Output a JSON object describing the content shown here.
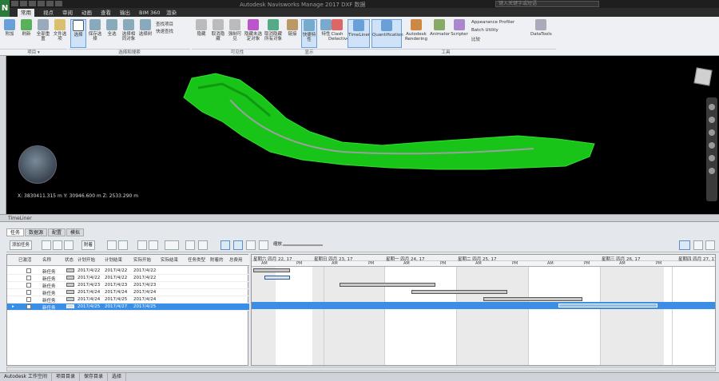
{
  "titlebar": {
    "title": "Autodesk Navisworks Manage 2017  DXF 数据",
    "search_placeholder": "键入关键字或短语"
  },
  "tabs": [
    "常用",
    "视点",
    "审阅",
    "动画",
    "查看",
    "输出",
    "BIM 360",
    "渲染"
  ],
  "ribbon": {
    "project_buttons": [
      "附加",
      "刷新",
      "全部重置",
      "文件选项"
    ],
    "select_buttons": [
      "选择",
      "保存选择",
      "全选",
      "选择相同对象",
      "选择树"
    ],
    "find_items": "查找项目",
    "quick_find": "快速查找",
    "select_group_label": "选择和搜索",
    "visibility_buttons": [
      "隐藏",
      "取消隐藏",
      "强制可见",
      "隐藏未选定对象",
      "取消隐藏所有对象"
    ],
    "visibility_group_label": "可见性",
    "display_buttons": [
      "链接",
      "快捷特性",
      "特性"
    ],
    "display_group_label": "显示",
    "tools_buttons": [
      "Clash Detective",
      "TimeLiner",
      "Quantification",
      "Autodesk Rendering",
      "Animator",
      "Scripter"
    ],
    "appearance_profiler": "Appearance Profiler",
    "batch_utility": "Batch Utility",
    "compare": "比较",
    "datatools": "DataTools",
    "tools_group_label": "工具"
  },
  "viewport": {
    "coords": "X: 3830411.315 m  Y: 30946.600 m  Z: 2533.290 m"
  },
  "panel": {
    "title": "TimeLiner",
    "tabs": [
      "任务",
      "数据源",
      "配置",
      "模拟"
    ],
    "toolbar": [
      "添加任务",
      "附着",
      "自动附着",
      "导出",
      "缩放"
    ]
  },
  "task_grid": {
    "headers": [
      "已激活",
      "名称",
      "状态",
      "计划开始",
      "计划结束",
      "实际开始",
      "实际结束",
      "任务类型",
      "附着的",
      "总费用"
    ],
    "rows": [
      {
        "name": "新任务",
        "start": "2017/4/22",
        "end": "2017/4/22",
        "actual": "2017/4/22",
        "selected": false
      },
      {
        "name": "新任务",
        "start": "2017/4/22",
        "end": "2017/4/22",
        "actual": "2017/4/22",
        "selected": false
      },
      {
        "name": "新任务",
        "start": "2017/4/23",
        "end": "2017/4/23",
        "actual": "2017/4/23",
        "selected": false
      },
      {
        "name": "新任务",
        "start": "2017/4/24",
        "end": "2017/4/24",
        "actual": "2017/4/24",
        "selected": false
      },
      {
        "name": "新任务",
        "start": "2017/4/24",
        "end": "2017/4/25",
        "actual": "2017/4/24",
        "selected": false
      },
      {
        "name": "新任务",
        "start": "2017/4/25",
        "end": "2017/4/27",
        "actual": "2017/4/25",
        "selected": true
      }
    ]
  },
  "gantt": {
    "days": [
      "星期六 四月 22, 17",
      "星期日 四月 23, 17",
      "星期一 四月 24, 17",
      "星期二 四月 25, 17",
      "星期三 四月 26, 17",
      "星期四 四月 27, 17"
    ],
    "half": [
      "AM",
      "PM"
    ]
  },
  "statusbar": [
    "Autodesk 工作空间",
    "项目目录",
    "保存目录",
    "选择"
  ]
}
